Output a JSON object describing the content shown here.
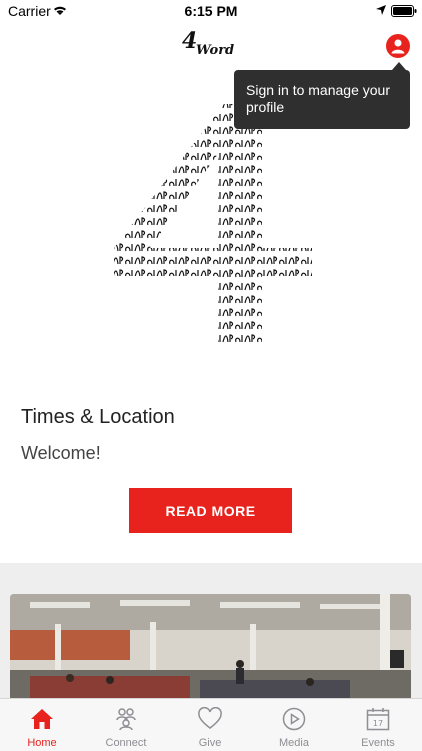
{
  "status_bar": {
    "carrier": "Carrier",
    "time": "6:15 PM",
    "icons": [
      "wifi-icon",
      "location-icon",
      "battery-icon"
    ]
  },
  "header": {
    "logo_text": "4 Word",
    "profile_icon": "user-icon"
  },
  "tooltip": {
    "text": "Sign in to manage your profile"
  },
  "main": {
    "section_title": "Times & Location",
    "welcome_text": "Welcome!",
    "read_more_label": "READ MORE"
  },
  "tabs": [
    {
      "label": "Home",
      "icon": "home-icon",
      "active": true
    },
    {
      "label": "Connect",
      "icon": "connect-icon",
      "active": false
    },
    {
      "label": "Give",
      "icon": "heart-icon",
      "active": false
    },
    {
      "label": "Media",
      "icon": "play-icon",
      "active": false
    },
    {
      "label": "Events",
      "icon": "calendar-icon",
      "active": false
    }
  ],
  "colors": {
    "accent": "#e8231e",
    "tab_inactive": "#8e8e93",
    "tooltip_bg": "#2f2f2f"
  }
}
